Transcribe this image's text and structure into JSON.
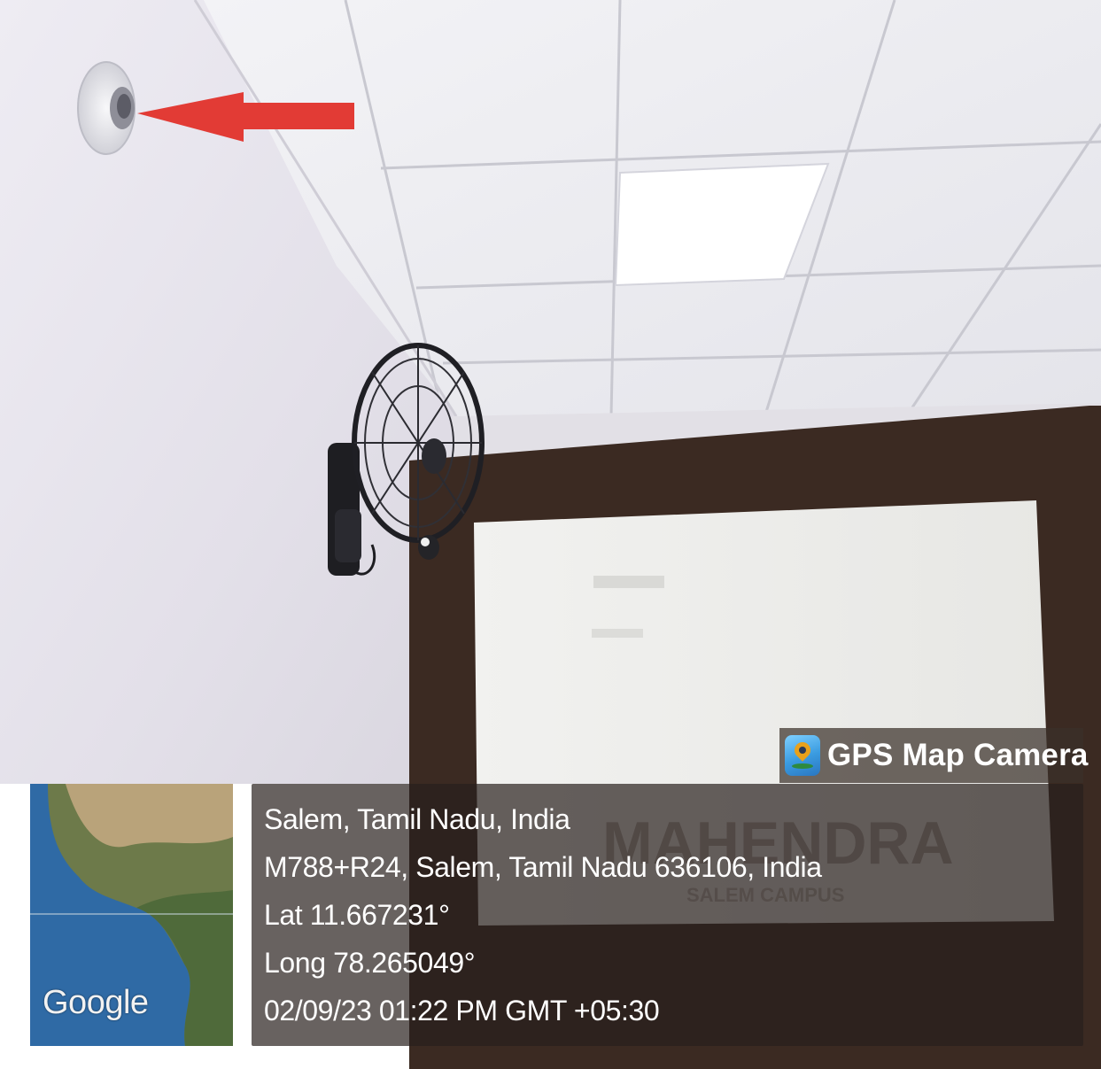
{
  "photo": {
    "subject": "ceiling-mounted-smoke-detector-with-red-arrow-and-wall-fan",
    "signage_text": "MAHENDRA",
    "signage_subtext": "SALEM CAMPUS"
  },
  "overlay": {
    "app_badge": {
      "icon": "gps-map-camera-app-icon",
      "title": "GPS Map Camera"
    },
    "minimap": {
      "provider_label": "Google"
    },
    "location": {
      "place": "Salem, Tamil Nadu, India",
      "address": "M788+R24, Salem, Tamil Nadu 636106, India",
      "latitude": "Lat 11.667231°",
      "longitude": "Long 78.265049°",
      "timestamp": "02/09/23 01:22 PM GMT +05:30"
    }
  },
  "colors": {
    "arrow": "#e23b35",
    "overlay_bg": "#2a2520",
    "ceiling": "#ececf0",
    "wall": "#e6e3ec",
    "door_frame": "#3b2a22"
  }
}
